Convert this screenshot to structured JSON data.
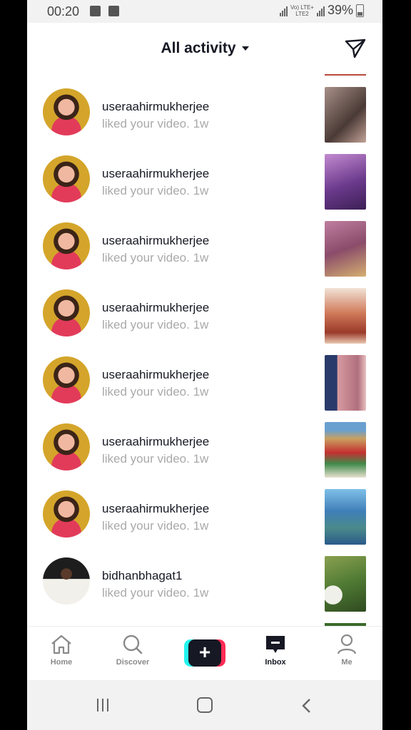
{
  "status_bar": {
    "time": "00:20",
    "network": "Vo) LTE+",
    "network2": "LTE2",
    "battery": "39%"
  },
  "header": {
    "title": "All activity"
  },
  "activities": [
    {
      "username": "useraahirmukherjee",
      "action": "liked your video.",
      "time": "1w",
      "thumb_color": "#7c6560"
    },
    {
      "username": "useraahirmukherjee",
      "action": "liked your video.",
      "time": "1w",
      "thumb_color": "#6b3a8c"
    },
    {
      "username": "useraahirmukherjee",
      "action": "liked your video.",
      "time": "1w",
      "thumb_color": "#a56a86"
    },
    {
      "username": "useraahirmukherjee",
      "action": "liked your video.",
      "time": "1w",
      "thumb_color": "#c4786a"
    },
    {
      "username": "useraahirmukherjee",
      "action": "liked your video.",
      "time": "1w",
      "thumb_color": "#b06f7e"
    },
    {
      "username": "useraahirmukherjee",
      "action": "liked your video.",
      "time": "1w",
      "thumb_color": "#5a9a66"
    },
    {
      "username": "useraahirmukherjee",
      "action": "liked your video.",
      "time": "1w",
      "thumb_color": "#3f7fb8"
    },
    {
      "username": "bidhanbhagat1",
      "action": "liked your video.",
      "time": "1w",
      "thumb_color": "#4f7a33"
    }
  ],
  "nav": {
    "home": "Home",
    "discover": "Discover",
    "inbox": "Inbox",
    "me": "Me"
  },
  "colors": {
    "accent_cyan": "#25f4ee",
    "accent_red": "#fe2c55",
    "text_dark": "#161823"
  },
  "icons": [
    "send-icon",
    "home-icon",
    "discover-icon",
    "plus-icon",
    "inbox-icon",
    "me-icon"
  ]
}
